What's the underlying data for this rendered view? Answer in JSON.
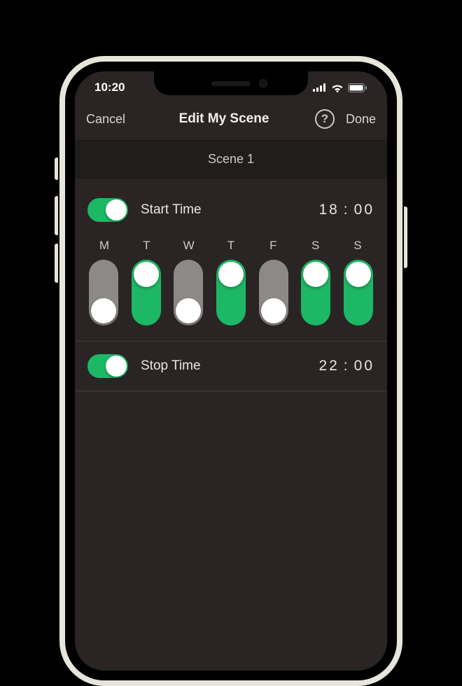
{
  "status": {
    "time": "10:20"
  },
  "nav": {
    "cancel_label": "Cancel",
    "title": "Edit My Scene",
    "help_glyph": "?",
    "done_label": "Done"
  },
  "sections": {
    "scene_header": "Scene 1"
  },
  "start": {
    "label": "Start Time",
    "hour": "18",
    "minute": "00",
    "enabled": true
  },
  "stop": {
    "label": "Stop Time",
    "hour": "22",
    "minute": "00",
    "enabled": true
  },
  "days": {
    "labels": [
      "M",
      "T",
      "W",
      "T",
      "F",
      "S",
      "S"
    ],
    "enabled": [
      false,
      true,
      false,
      true,
      false,
      true,
      true
    ]
  },
  "colors": {
    "accent": "#1db866"
  }
}
